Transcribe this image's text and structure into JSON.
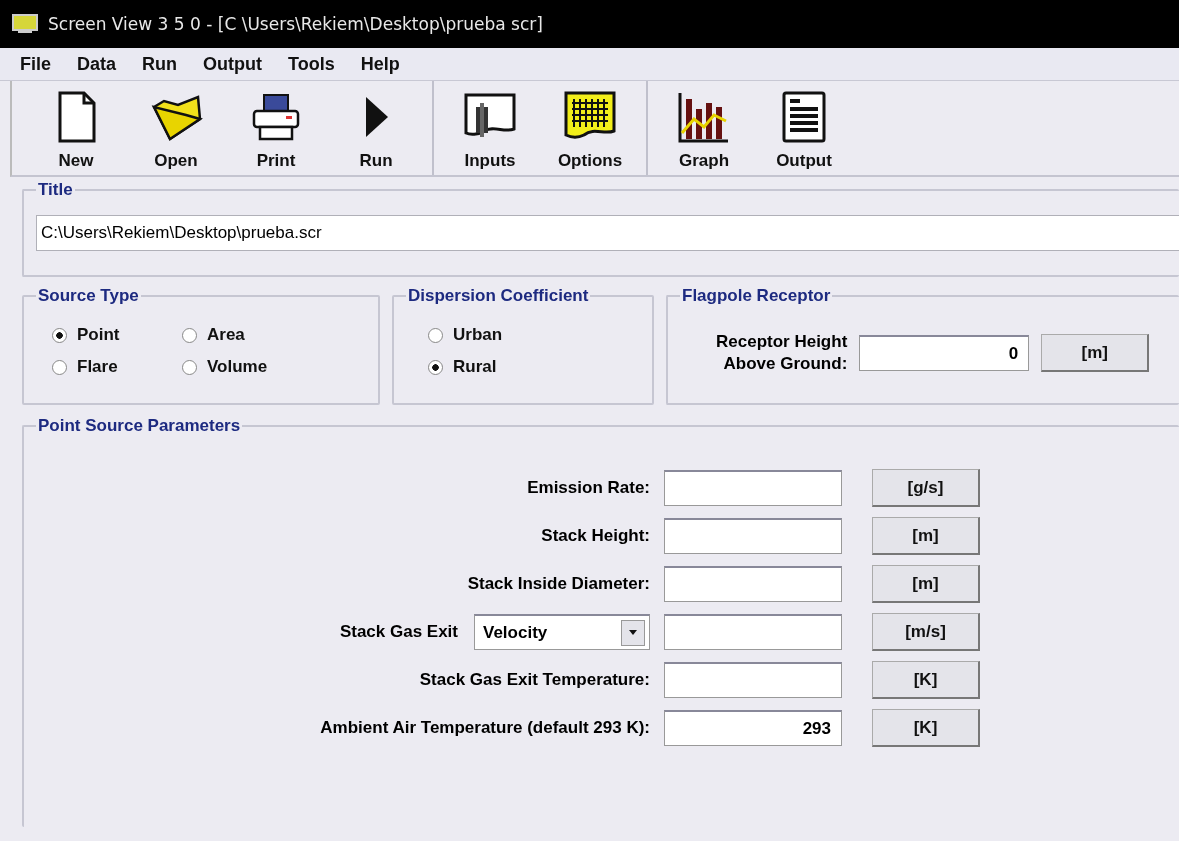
{
  "window": {
    "title": "Screen View 3 5 0 - [C \\Users\\Rekiem\\Desktop\\prueba scr]"
  },
  "menu": [
    "File",
    "Data",
    "Run",
    "Output",
    "Tools",
    "Help"
  ],
  "toolbar": {
    "groups": [
      {
        "buttons": [
          {
            "label": "New",
            "kind": "new"
          },
          {
            "label": "Open",
            "kind": "open"
          },
          {
            "label": "Print",
            "kind": "print"
          },
          {
            "label": "Run",
            "kind": "run"
          }
        ]
      },
      {
        "buttons": [
          {
            "label": "Inputs",
            "kind": "inputs"
          },
          {
            "label": "Options",
            "kind": "options"
          }
        ]
      },
      {
        "buttons": [
          {
            "label": "Graph",
            "kind": "graph"
          },
          {
            "label": "Output",
            "kind": "output"
          }
        ]
      }
    ]
  },
  "title_group": {
    "legend": "Title",
    "value": "C:\\Users\\Rekiem\\Desktop\\prueba.scr"
  },
  "source_type": {
    "legend": "Source Type",
    "options": [
      {
        "label": "Point",
        "selected": true
      },
      {
        "label": "Area",
        "selected": false
      },
      {
        "label": "Flare",
        "selected": false
      },
      {
        "label": "Volume",
        "selected": false
      }
    ]
  },
  "dispersion_coefficient": {
    "legend": "Dispersion Coefficient",
    "options": [
      {
        "label": "Urban",
        "selected": false
      },
      {
        "label": "Rural",
        "selected": true
      }
    ]
  },
  "flagpole_receptor": {
    "legend": "Flagpole Receptor",
    "label_lines": [
      "Receptor Height",
      "Above Ground:"
    ],
    "value": "0",
    "unit": "[m]"
  },
  "point_source_parameters": {
    "legend": "Point Source Parameters",
    "rows": [
      {
        "kind": "field",
        "label": "Emission Rate:",
        "unit": "[g/s]"
      },
      {
        "kind": "field",
        "label": "Stack Height:",
        "unit": "[m]"
      },
      {
        "kind": "field",
        "label": "Stack Inside Diameter:",
        "unit": "[m]"
      },
      {
        "kind": "select",
        "label": "Stack Gas Exit",
        "option": "Velocity",
        "unit": "[m/s]"
      },
      {
        "kind": "field",
        "label": "Stack Gas Exit Temperature:",
        "unit": "[K]"
      },
      {
        "kind": "field",
        "label": "Ambient Air Temperature (default 293 K):",
        "value": "293",
        "unit": "[K]"
      }
    ]
  }
}
